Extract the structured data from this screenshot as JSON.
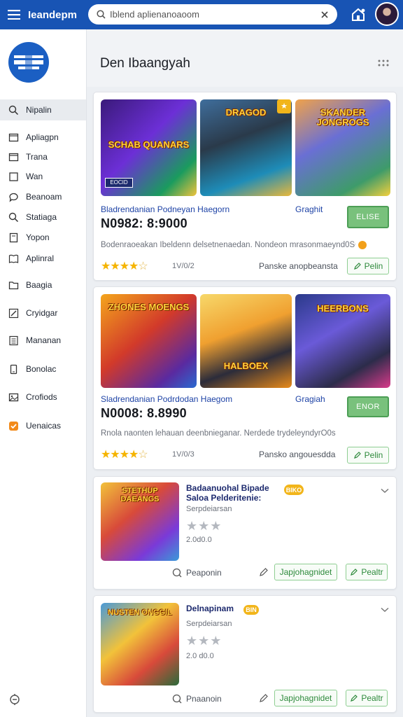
{
  "app": {
    "brand": "Ieandepm"
  },
  "search": {
    "value": "Iblend aplienanoaoom"
  },
  "page": {
    "title": "Den Ibaangyah"
  },
  "sidebar": {
    "items": [
      {
        "label": "Nipalin"
      },
      {
        "label": "Apliagpn"
      },
      {
        "label": "Trana"
      },
      {
        "label": "Wan"
      },
      {
        "label": "Beanoam"
      },
      {
        "label": "Statiaga"
      },
      {
        "label": "Yopon"
      },
      {
        "label": "Aplinral"
      },
      {
        "label": "Baagia"
      },
      {
        "label": "Cryidgar"
      },
      {
        "label": "Mananan"
      },
      {
        "label": "Bonolac"
      },
      {
        "label": "Crofiods"
      },
      {
        "label": "Uenaicas"
      }
    ]
  },
  "featured": [
    {
      "thumbs": [
        "SCHAB QUANARS",
        "DRAGOD",
        "SKANDER JONGROGS"
      ],
      "thumb_sub": "EOCID",
      "title": "Bladrendanian Podneyan Haegorn",
      "category": "Graghit",
      "price": "N0982: 8:9000",
      "description": "Bodenraoeakan Ibeldenn delsetnenaedan. Nondeon mrasonmaeynd0SOs",
      "rating_count": "1V/0/2",
      "meta": "Panske anopbeansta",
      "badge_button": "ELISE",
      "action_button": "Pelin"
    },
    {
      "thumbs": [
        "ZHONES MOENGS",
        "HALBOEX",
        "HEERBONS"
      ],
      "thumb_sub": "",
      "title": "Sladrendanian Podrdodan Haegom",
      "category": "Gragiah",
      "price": "N0008: 8.8990",
      "description": "Rnola naonten lehauan deenbnieganar. Nerdede trydeleyndyrO0s",
      "rating_count": "1V/0/3",
      "meta": "Pansko angouesdda",
      "badge_button": "ENOR",
      "action_button": "Pelin"
    }
  ],
  "list": [
    {
      "thumb": "STETHUP DAEANGS",
      "title": "Badaanuohal Bipade Saloa Pelderitenie:",
      "badge": "BIKO",
      "subtitle": "Serpdeiarsan",
      "rating": "2.0d0.0",
      "meta": "Peaponin",
      "secondary_button": "Japjohagnidet",
      "action_button": "Pealtr"
    },
    {
      "thumb": "NUSTEN ONGGIL",
      "title": "Delnapinam",
      "badge": "BIN",
      "subtitle": "Serpdeiarsan",
      "rating": "2.0 d0.0",
      "meta": "Pnaanoin",
      "secondary_button": "Japjohagnidet",
      "action_button": "Pealtr"
    }
  ],
  "colors": {
    "topbar": "#1854b4",
    "accent_green": "#79c17c",
    "link_blue": "#1e43a6",
    "star": "#f5b400"
  }
}
